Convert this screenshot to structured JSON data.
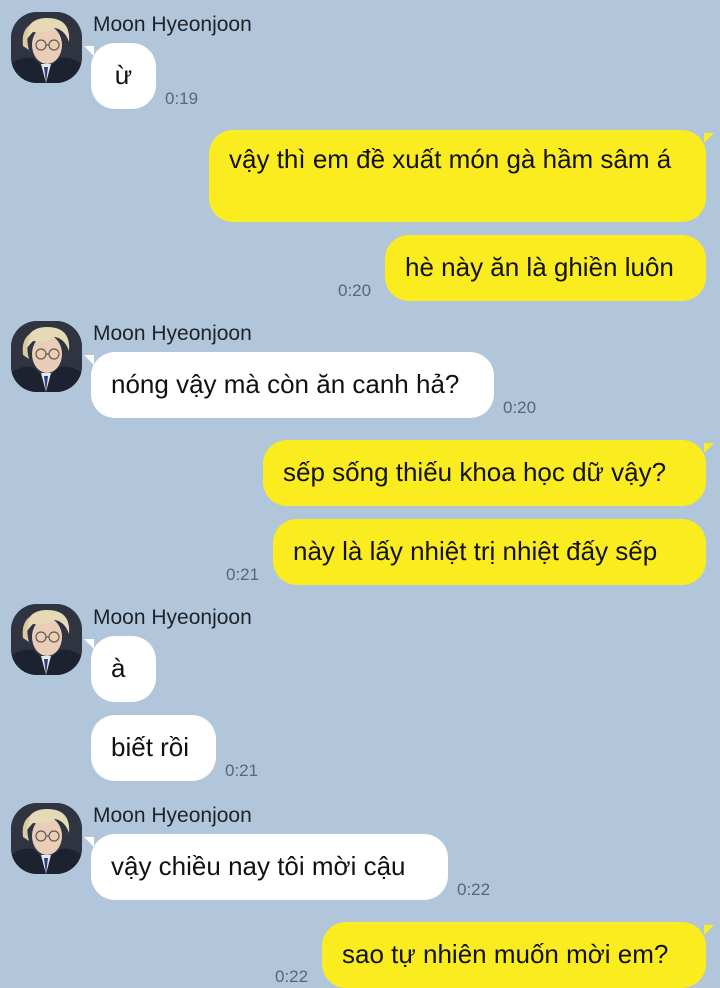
{
  "colors": {
    "background": "#b1c6da",
    "incoming_bubble": "#ffffff",
    "outgoing_bubble": "#fbec1f"
  },
  "contact_name": "Moon Hyeonjoon",
  "messages": [
    {
      "from": "contact",
      "text": "ừ",
      "time": "0:19"
    },
    {
      "from": "me",
      "text": "vậy thì em đề xuất món gà hầm sâm á"
    },
    {
      "from": "me",
      "text": "hè này ăn là ghiền luôn",
      "time": "0:20"
    },
    {
      "from": "contact",
      "text": "nóng vậy mà còn ăn canh hả?",
      "time": "0:20"
    },
    {
      "from": "me",
      "text": "sếp sống thiếu khoa học dữ vậy?"
    },
    {
      "from": "me",
      "text": "này là lấy nhiệt trị nhiệt đấy sếp",
      "time": "0:21"
    },
    {
      "from": "contact",
      "text": "à"
    },
    {
      "from": "contact",
      "text": "biết rồi",
      "time": "0:21"
    },
    {
      "from": "contact",
      "text": "vậy chiều nay tôi mời cậu",
      "time": "0:22"
    },
    {
      "from": "me",
      "text": "sao tự nhiên muốn mời em?",
      "time": "0:22"
    }
  ]
}
